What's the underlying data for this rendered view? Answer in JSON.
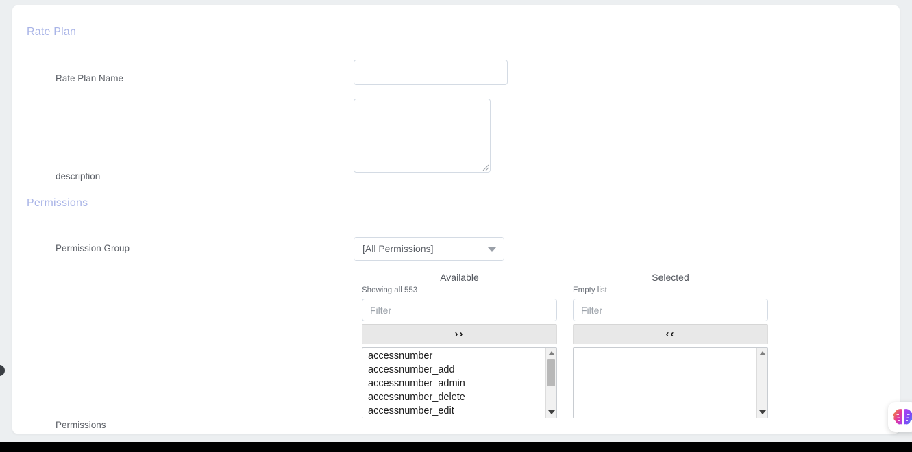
{
  "sections": {
    "rate_plan": {
      "heading": "Rate Plan"
    },
    "permissions": {
      "heading": "Permissions"
    }
  },
  "fields": {
    "rate_plan_name": {
      "label": "Rate Plan Name",
      "value": "",
      "placeholder": ""
    },
    "description": {
      "label": "description",
      "value": "",
      "placeholder": ""
    },
    "permission_group": {
      "label": "Permission Group",
      "selected": "[All Permissions]",
      "caret_icon": "chevron-down-icon"
    },
    "permissions": {
      "label": "Permissions"
    }
  },
  "picklist": {
    "available": {
      "title": "Available",
      "status": "Showing all 553",
      "filter_placeholder": "Filter",
      "filter_value": "",
      "transfer_label": "››",
      "transfer_icon": "double-chevron-right-icon",
      "items": [
        "accessnumber",
        "accessnumber_add",
        "accessnumber_admin",
        "accessnumber_delete",
        "accessnumber_edit"
      ]
    },
    "selected": {
      "title": "Selected",
      "status": "Empty list",
      "filter_placeholder": "Filter",
      "filter_value": "",
      "transfer_label": "‹‹",
      "transfer_icon": "double-chevron-left-icon",
      "items": []
    }
  },
  "widgets": {
    "brain_assistant": {
      "icon": "brain-icon"
    },
    "left_drawer": {
      "icon": "drawer-handle-icon"
    }
  },
  "colors": {
    "heading_accent": "#a9b4e7",
    "label_text": "#5b5f66",
    "input_border": "#d4dbe4",
    "page_backdrop": "#eceff1",
    "card_background": "#ffffff",
    "transfer_button_background": "#e8e8e8",
    "list_text": "#1c1c1c"
  }
}
